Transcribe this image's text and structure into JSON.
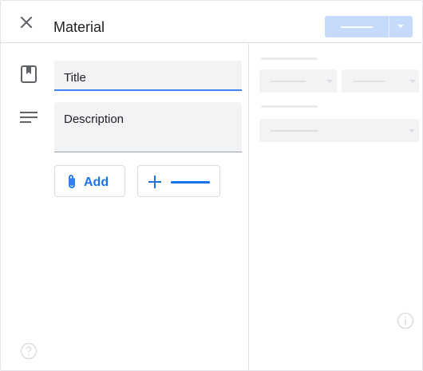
{
  "header": {
    "title": "Material",
    "close_icon": "close-icon",
    "primary_action": "split-button"
  },
  "form": {
    "title_label": "Title",
    "description_label": "Description",
    "title_icon": "bookmark-icon",
    "description_icon": "notes-icon"
  },
  "actions": {
    "add_label": "Add",
    "add_icon": "paperclip-icon",
    "create_icon": "plus-icon"
  },
  "footer": {
    "help_icon": "help-circle-icon",
    "info_icon": "info-circle-icon"
  },
  "colors": {
    "accent": "#1a73e8",
    "focus_underline": "#4285f4",
    "disabled_button": "#c6dafc",
    "field_fill": "#f1f3f4",
    "skeleton": "#e8eaed"
  }
}
